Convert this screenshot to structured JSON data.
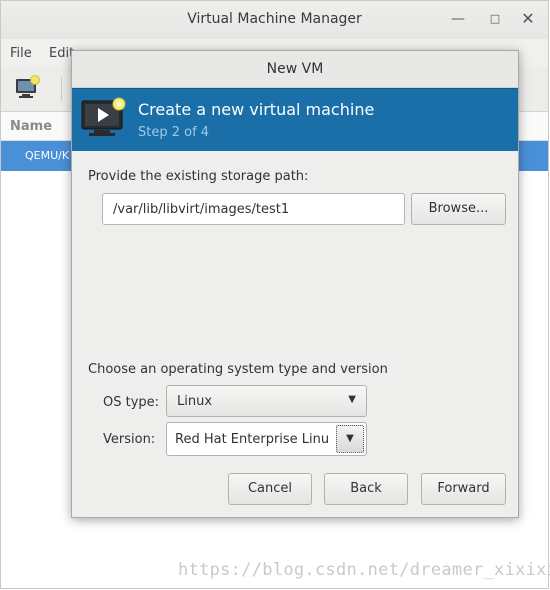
{
  "main_window": {
    "title": "Virtual Machine Manager",
    "menu": {
      "file": "File",
      "edit": "Edit"
    },
    "list_header": "Name",
    "vm_row": "QEMU/K"
  },
  "dialog": {
    "title": "New VM",
    "banner": {
      "title": "Create a new virtual machine",
      "step": "Step 2 of 4"
    },
    "storage_label": "Provide the existing storage path:",
    "storage_path": "/var/lib/libvirt/images/test1",
    "browse_label": "Browse...",
    "os_section_label": "Choose an operating system type and version",
    "os_type_label": "OS type:",
    "os_type_value": "Linux",
    "version_label": "Version:",
    "version_value": "Red Hat Enterprise Linu",
    "buttons": {
      "cancel": "Cancel",
      "back": "Back",
      "forward": "Forward"
    }
  },
  "watermark": "https://blog.csdn.net/dreamer_xixixi",
  "colors": {
    "banner": "#1a6fa8",
    "selection": "#4a90d9"
  }
}
